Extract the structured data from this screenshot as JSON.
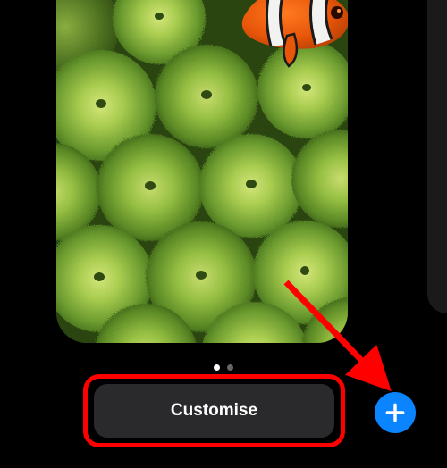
{
  "wallpaper": {
    "subject": "clownfish-anemone"
  },
  "page_indicator": {
    "count": 2,
    "active_index": 0
  },
  "buttons": {
    "customise_label": "Customise",
    "add_label": "+"
  },
  "annotation": {
    "highlight_target": "customise-button",
    "arrow_target": "add-button"
  },
  "colors": {
    "accent": "#0a84ff",
    "annotation": "#ff0000",
    "button_bg": "#2a2a2c"
  }
}
